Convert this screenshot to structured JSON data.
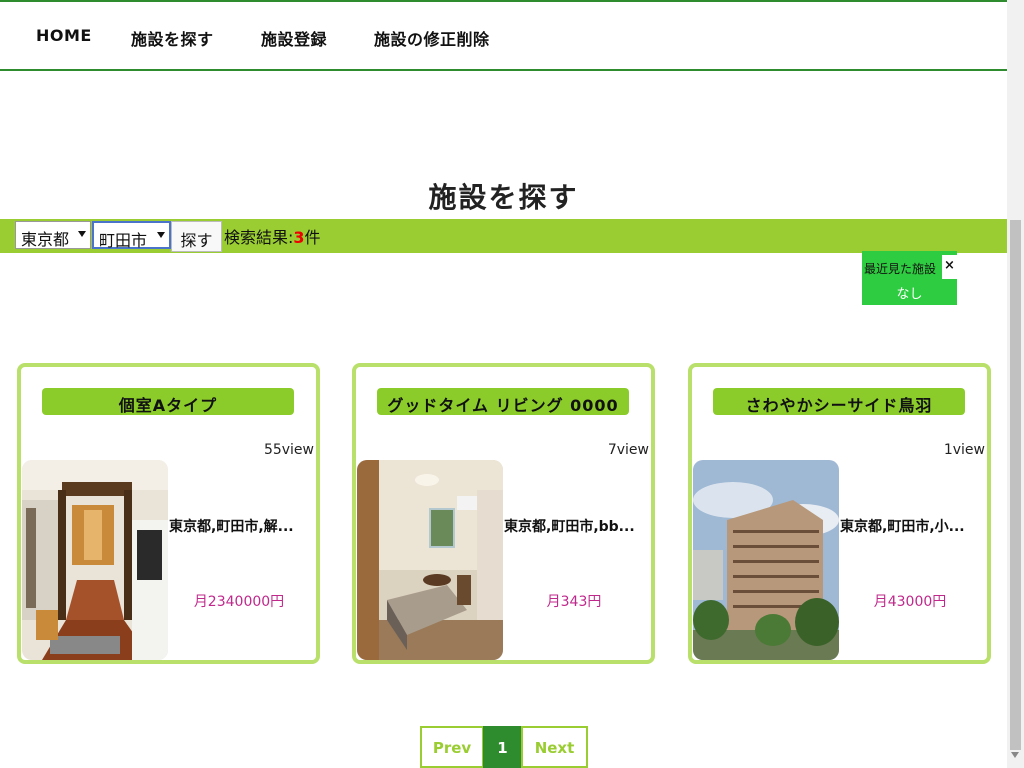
{
  "nav": {
    "home": "HOME",
    "search": "施設を探す",
    "register": "施設登録",
    "edit": "施設の修正削除"
  },
  "page_title": "施設を探す",
  "search": {
    "prefecture": "東京都",
    "city": "町田市",
    "button": "探す",
    "result_label": "検索結果:",
    "result_count": "3",
    "result_unit": "件"
  },
  "recent": {
    "title": "最近見た施設",
    "close": "×",
    "empty": "なし"
  },
  "cards": [
    {
      "title": "個室Aタイプ",
      "views": "55view",
      "address": "東京都,町田市,解...",
      "price": "月2340000円",
      "image": "hallway-photo"
    },
    {
      "title": "グッドタイム リビング 0000",
      "views": "7view",
      "address": "東京都,町田市,bb...",
      "price": "月343円",
      "image": "bedroom-photo"
    },
    {
      "title": "さわやかシーサイド鳥羽",
      "views": "1view",
      "address": "東京都,町田市,小...",
      "price": "月43000円",
      "image": "building-photo"
    }
  ],
  "pagination": {
    "prev": "Prev",
    "current": "1",
    "next": "Next"
  },
  "colors": {
    "accent_green": "#9acd32",
    "dark_green": "#2e8b2e",
    "price_color": "#c0288c",
    "recent_bg": "#2ecc40"
  }
}
